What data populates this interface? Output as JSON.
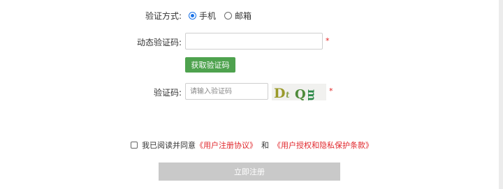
{
  "verify_method": {
    "label": "验证方式:",
    "options": [
      {
        "label": "手机",
        "checked": true
      },
      {
        "label": "邮箱",
        "checked": false
      }
    ]
  },
  "dynamic_code": {
    "label": "动态验证码:",
    "value": "",
    "placeholder": "",
    "required_mark": "*"
  },
  "get_code_button": {
    "label": "获取验证码"
  },
  "captcha": {
    "label": "验证码:",
    "placeholder": "请输入验证码",
    "value": "",
    "image_text": "DtQ3",
    "required_mark": "*"
  },
  "agreement": {
    "prefix": "我已阅读并同意",
    "link1": "《用户注册协议》",
    "conjunction": "和",
    "link2": "《用户授权和隐私保护条款》",
    "checked": false
  },
  "register_button": {
    "label": "立即注册"
  },
  "colors": {
    "accent_blue": "#1a73e8",
    "green_button": "#4ea24e",
    "required_red": "#e02020",
    "link_red": "#e0262b",
    "disabled_gray": "#c9c9c9"
  }
}
